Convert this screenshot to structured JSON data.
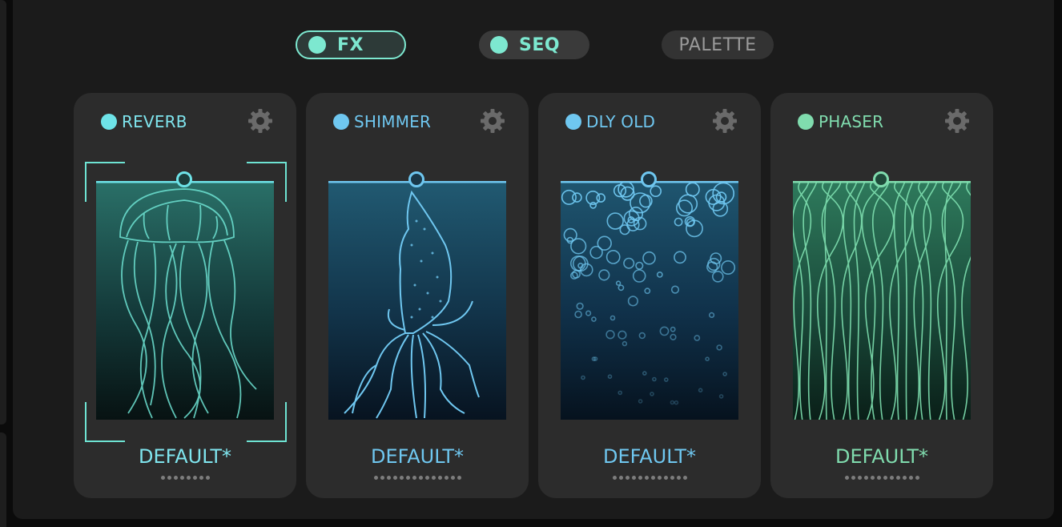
{
  "tabs": [
    {
      "label": "FX",
      "active": true,
      "dot_color": "#7de8d0"
    },
    {
      "label": "SEQ",
      "active": false,
      "dot_color": "#7de8d0"
    },
    {
      "label": "PALETTE",
      "active": false
    }
  ],
  "colors": {
    "accent_teal": "#7de8d0",
    "accent_blue": "#6fc3ea",
    "accent_green": "#7fdcb0",
    "card_bg": "#2c2c2c",
    "panel_bg": "#1b1b1b"
  },
  "cards": [
    {
      "name": "REVERB",
      "led_color": "#6ee3e8",
      "text_color": "#7fe5ee",
      "preset": "DEFAULT*",
      "dots": 8,
      "art": "jellyfish",
      "selected": true,
      "settings_icon": "gear-icon"
    },
    {
      "name": "SHIMMER",
      "led_color": "#6fc7f0",
      "text_color": "#6fc7f0",
      "preset": "DEFAULT*",
      "dots": 14,
      "art": "squid",
      "selected": false,
      "settings_icon": "gear-icon"
    },
    {
      "name": "DLY OLD",
      "led_color": "#6fc7f0",
      "text_color": "#6fc7f0",
      "preset": "DEFAULT*",
      "dots": 12,
      "art": "bubbles",
      "selected": false,
      "settings_icon": "gear-icon"
    },
    {
      "name": "PHASER",
      "led_color": "#80dcae",
      "text_color": "#80dcae",
      "preset": "DEFAULT*",
      "dots": 12,
      "art": "seaweed",
      "selected": false,
      "settings_icon": "gear-icon"
    }
  ]
}
